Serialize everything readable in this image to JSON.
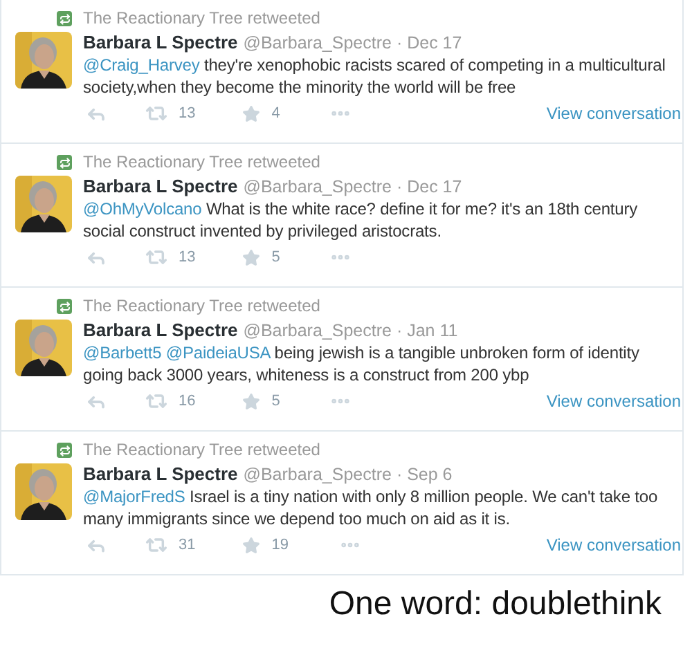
{
  "tweets": [
    {
      "retweeted_by": "The Reactionary Tree retweeted",
      "name": "Barbara L Spectre",
      "handle": "@Barbara_Spectre",
      "date": "· Dec 17",
      "mentions": [
        "@Craig_Harvey"
      ],
      "text": "they're xenophobic racists scared of competing in a multicultural society,when they become the minority the world will be free",
      "retweets": "13",
      "favorites": "4",
      "view_conversation": "View conversation"
    },
    {
      "retweeted_by": "The Reactionary Tree retweeted",
      "name": "Barbara L Spectre",
      "handle": "@Barbara_Spectre",
      "date": "· Dec 17",
      "mentions": [
        "@OhMyVolcano"
      ],
      "text": "What is the white race? define it for me? it's an 18th century social construct invented by privileged aristocrats.",
      "retweets": "13",
      "favorites": "5"
    },
    {
      "retweeted_by": "The Reactionary Tree retweeted",
      "name": "Barbara L Spectre",
      "handle": "@Barbara_Spectre",
      "date": "· Jan 11",
      "mentions": [
        "@Barbett5",
        "@PaideiaUSA"
      ],
      "text": "being jewish is a tangible unbroken form of identity going back 3000 years, whiteness is a construct from 200 ybp",
      "retweets": "16",
      "favorites": "5",
      "view_conversation": "View conversation"
    },
    {
      "retweeted_by": "The Reactionary Tree retweeted",
      "name": "Barbara L Spectre",
      "handle": "@Barbara_Spectre",
      "date": "· Sep 6",
      "mentions": [
        "@MajorFredS"
      ],
      "text": "Israel is a tiny nation with only 8 million people. We can't take too many immigrants since we depend too much on aid as it is.",
      "retweets": "31",
      "favorites": "19",
      "view_conversation": "View conversation"
    }
  ],
  "caption": "One word: doublethink"
}
